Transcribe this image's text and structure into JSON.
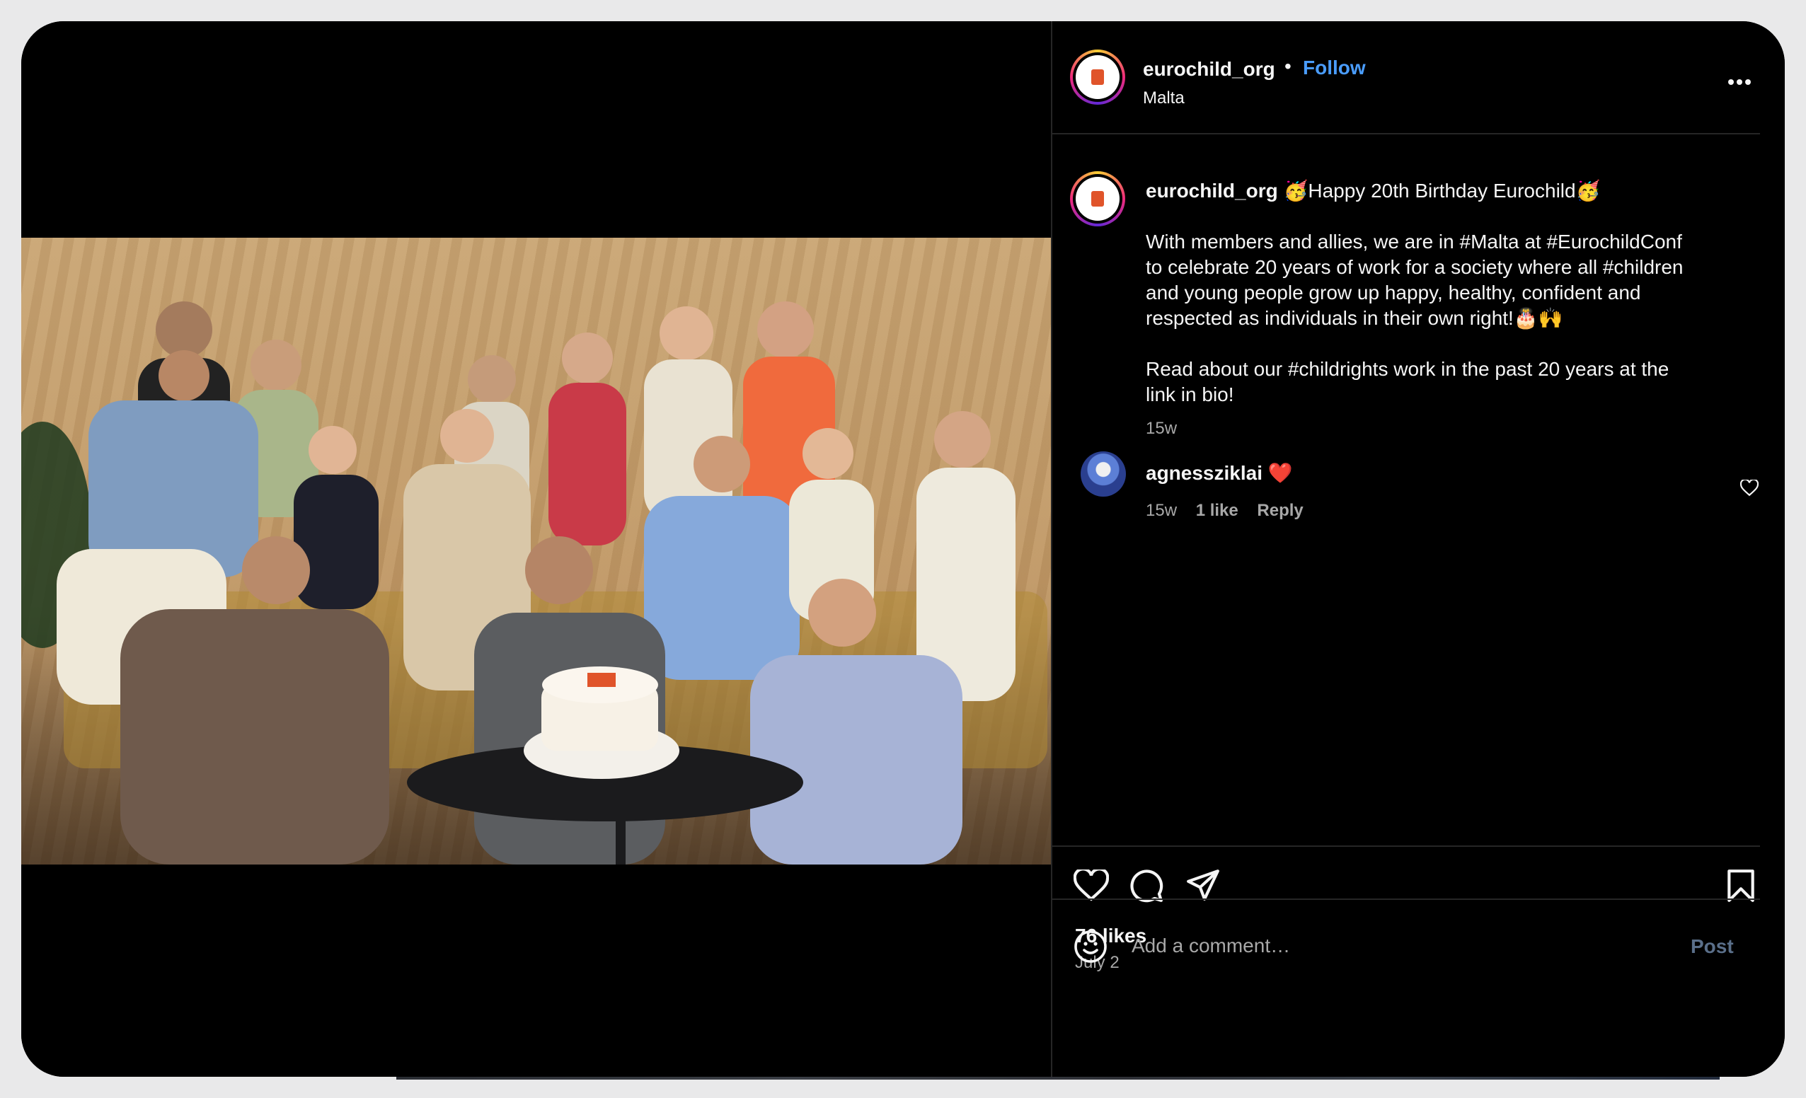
{
  "post": {
    "account": "eurochild_org",
    "separator": "•",
    "follow_label": "Follow",
    "location": "Malta",
    "more_label": "More options",
    "caption_user": "eurochild_org",
    "caption_emoji": "🥳",
    "caption_title": "Happy 20th Birthday Eurochild",
    "caption_emoji_end": "🥳",
    "caption_body": "With members and allies, we are in #Malta at #EurochildConf\nto celebrate 20 years of work for a society where all #children\nand young people grow up happy, healthy, confident and\nrespected as individuals in their own right!🎂🙌\n\nRead about our #childrights work in the past 20 years at the\nlink in bio!",
    "caption_age": "15w",
    "photo_alt": "Group photo of Eurochild team with a birthday cake"
  },
  "comment": {
    "user": "agnessziklai",
    "heart": "❤️",
    "age": "15w",
    "likes": "1 like",
    "reply_label": "Reply"
  },
  "actions": {
    "likes": "76 likes",
    "date": "July 2"
  },
  "add_comment": {
    "placeholder": "Add a comment…",
    "post_label": "Post"
  },
  "colors": {
    "background": "#000000",
    "link_blue": "#4a9dff",
    "muted": "#a8a8a8",
    "heart_red": "#ff3040"
  },
  "icons": {
    "like": "heart-icon",
    "comment": "comment-bubble-icon",
    "share": "paper-plane-icon",
    "save": "bookmark-icon",
    "emoji": "smiley-icon",
    "comment_like": "small-heart-icon"
  }
}
